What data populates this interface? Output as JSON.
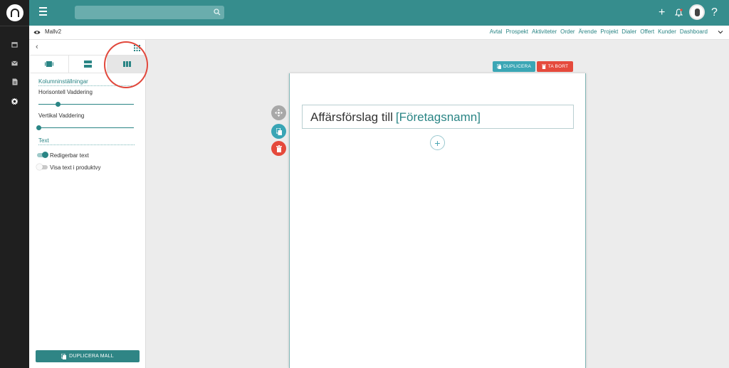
{
  "sidebar": {
    "items": [
      {
        "icon": "calendar-icon"
      },
      {
        "icon": "mail-icon"
      },
      {
        "icon": "document-icon"
      },
      {
        "icon": "gear-icon",
        "active": true
      }
    ]
  },
  "topbar": {
    "search_placeholder": "",
    "add_label": "+",
    "help_label": "?"
  },
  "subnav": {
    "template_name": "Mallv2",
    "links": [
      "Avtal",
      "Prospekt",
      "Aktiviteter",
      "Order",
      "Ärende",
      "Projekt",
      "Dialer",
      "Offert",
      "Kunder",
      "Dashboard"
    ]
  },
  "panel": {
    "back_label": "‹",
    "tabs": [
      {
        "icon": "box-layout-icon"
      },
      {
        "icon": "rows-layout-icon"
      },
      {
        "icon": "columns-layout-icon",
        "active": true
      }
    ],
    "column_settings_title": "Kolumninställningar",
    "horizontal_padding_label": "Horisontell Vaddering",
    "horizontal_padding_value": 0.2,
    "vertical_padding_label": "Vertikal Vaddering",
    "vertical_padding_value": 0.0,
    "text_title": "Text",
    "editable_text_label": "Redigerbar text",
    "editable_text_on": true,
    "show_text_label": "Visa text i produktvy",
    "show_text_on": false,
    "duplicate_template_label": "DUPLICERA MALL"
  },
  "canvas": {
    "duplicate_label": "DUPLICERA",
    "remove_label": "TA BORT",
    "heading": "Affärsförslag till",
    "heading_placeholder": "[Företagsnamn]",
    "add_label": "+"
  },
  "colors": {
    "brand": "#368d8d",
    "accent": "#2a8585",
    "danger": "#e54a3c",
    "info": "#3ba6b5"
  }
}
